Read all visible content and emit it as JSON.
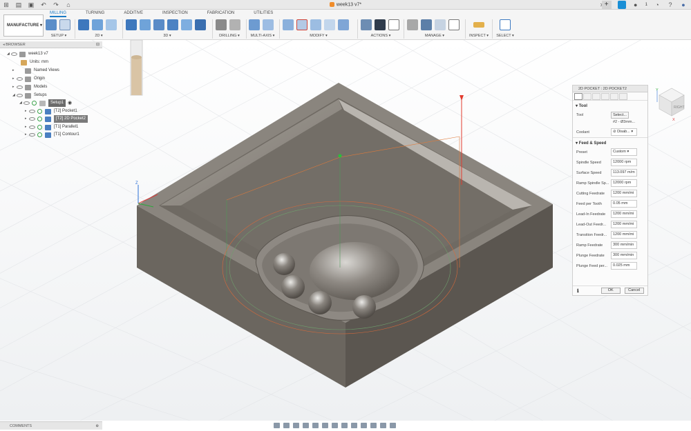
{
  "window": {
    "title": "week13 v7*",
    "extensions_badge": "1"
  },
  "ribbon": {
    "workspace": "MANUFACTURE",
    "tabs": [
      "MILLING",
      "TURNING",
      "ADDITIVE",
      "INSPECTION",
      "FABRICATION",
      "UTILITIES"
    ],
    "active_tab": "MILLING",
    "groups": [
      "SETUP",
      "2D",
      "3D",
      "DRILLING",
      "MULTI-AXIS",
      "MODIFY",
      "ACTIONS",
      "MANAGE",
      "INSPECT",
      "SELECT"
    ]
  },
  "browser": {
    "title": "BROWSER",
    "items": [
      {
        "label": "week13 v7"
      },
      {
        "label": "Units: mm"
      },
      {
        "label": "Named Views"
      },
      {
        "label": "Origin"
      },
      {
        "label": "Models"
      },
      {
        "label": "Setups"
      },
      {
        "label": "Setup1"
      },
      {
        "label": "[T2] Pocket1"
      },
      {
        "label": "[T2] 2D Pocket2"
      },
      {
        "label": "[T1] Parallel1"
      },
      {
        "label": "[T1] Contour1"
      }
    ]
  },
  "panel": {
    "title": "2D POCKET : 2D POCKET2",
    "tool_section": "Tool",
    "tool_label": "Tool",
    "tool_button": "Select...",
    "tool_desc": "#2 - Ø3mm...",
    "coolant_label": "Coolant",
    "coolant_value": "Disab...",
    "feed_section": "Feed & Speed",
    "fields": [
      {
        "label": "Preset",
        "value": "Custom"
      },
      {
        "label": "Spindle Speed",
        "value": "12000 rpm"
      },
      {
        "label": "Surface Speed",
        "value": "113.097 m/m"
      },
      {
        "label": "Ramp Spindle Sp...",
        "value": "12000 rpm"
      },
      {
        "label": "Cutting Feedrate",
        "value": "1200 mm/mi"
      },
      {
        "label": "Feed per Tooth",
        "value": "0.05 mm"
      },
      {
        "label": "Lead-In Feedrate",
        "value": "1200 mm/mi"
      },
      {
        "label": "Lead-Out Feedr...",
        "value": "1200 mm/mi"
      },
      {
        "label": "Transition Feedr...",
        "value": "1200 mm/mi"
      },
      {
        "label": "Ramp Feedrate",
        "value": "300 mm/min"
      },
      {
        "label": "Plunge Feedrate",
        "value": "300 mm/min"
      },
      {
        "label": "Plunge Feed per...",
        "value": "0.025 mm"
      }
    ],
    "ok": "OK",
    "cancel": "Cancel"
  },
  "viewcube": {
    "right": "RIGHT",
    "axis_x": "X",
    "axis_y": "Y",
    "axis_z": "Z"
  },
  "comments": "COMMENTS",
  "colors": {
    "accent": "#1a7bc6",
    "model": "#6f6a63",
    "toolpath_red": "#e23b2e"
  }
}
